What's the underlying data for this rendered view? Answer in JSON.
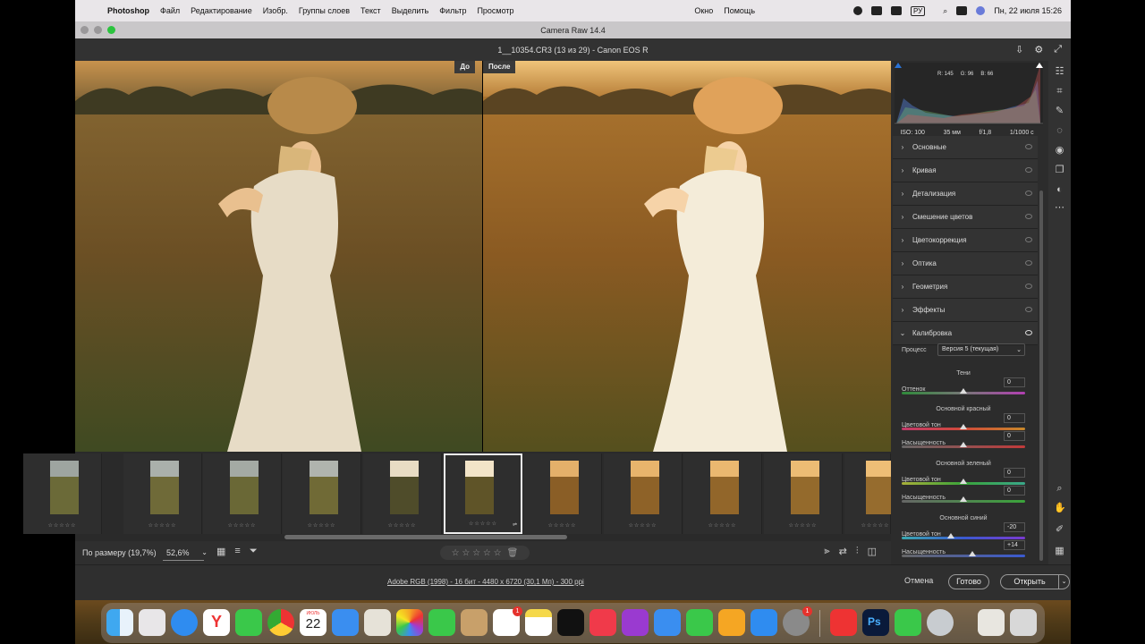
{
  "menubar": {
    "app_name": "Photoshop",
    "items": [
      "Файл",
      "Редактирование",
      "Изобр.",
      "Группы слоев",
      "Текст",
      "Выделить",
      "Фильтр",
      "Просмотр"
    ],
    "window": "Окно",
    "help": "Помощь",
    "keyboard": "РУ",
    "clock": "Пн, 22 июля  15:26"
  },
  "window": {
    "title": "Camera Raw 14.4"
  },
  "header": {
    "file_info": "1__10354.CR3 (13 из 29)  -  Canon EOS R"
  },
  "compare": {
    "before_label": "До",
    "after_label": "После"
  },
  "histogram": {
    "r": "R: 145",
    "g": "G: 96",
    "b": "B: 66",
    "iso": "ISO: 100",
    "focal": "35 мм",
    "aperture": "f/1,8",
    "shutter": "1/1000 с"
  },
  "panel": {
    "sections": [
      "Основные",
      "Кривая",
      "Детализация",
      "Смешение цветов",
      "Цветокоррекция",
      "Оптика",
      "Геометрия",
      "Эффекты"
    ],
    "calibration_title": "Калибровка",
    "process_label": "Процесс",
    "process_value": "Версия 5 (текущая)",
    "shadows_title": "Тени",
    "tint_label": "Оттенок",
    "tint_value": "0",
    "red_title": "Основной красный",
    "red_hue_label": "Цветовой тон",
    "red_hue_value": "0",
    "red_sat_label": "Насыщенность",
    "red_sat_value": "0",
    "green_title": "Основной зеленый",
    "green_hue_label": "Цветовой тон",
    "green_hue_value": "0",
    "green_sat_label": "Насыщенность",
    "green_sat_value": "0",
    "blue_title": "Основной синий",
    "blue_hue_label": "Цветовой тон",
    "blue_hue_value": "-20",
    "blue_sat_label": "Насыщенность",
    "blue_sat_value": "+14"
  },
  "filmstrip": {
    "stars": "☆☆☆☆☆",
    "selected_index": 5,
    "count": 10
  },
  "toolbar": {
    "fit_label": "По размеру (19,7%)",
    "zoom_value": "52,6%",
    "rating": "☆ ☆ ☆ ☆ ☆"
  },
  "footer": {
    "info": "Adobe RGB (1998) - 16 бит - 4480 x 6720 (30,1 Мп) - 300 ppi",
    "cancel": "Отмена",
    "done": "Готово",
    "open": "Открыть"
  },
  "dock": {
    "calendar_month": "ИЮЛЬ",
    "calendar_day": "22",
    "reminders_badge": "1",
    "settings_badge": "1"
  },
  "colors": {
    "panel_bg": "#2c2c2c",
    "accent_white": "#eeeeee"
  }
}
